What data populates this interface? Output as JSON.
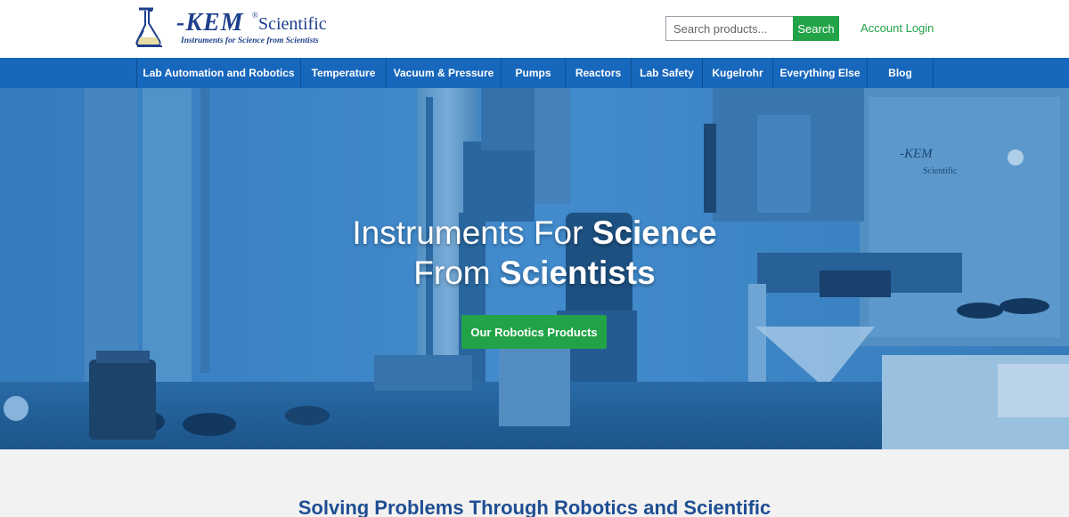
{
  "brand": {
    "logo_name": "-KEM",
    "logo_registered": "®",
    "logo_scientific": "Scientific",
    "logo_tagline": "Instruments for Science from Scientists",
    "primary_color": "#1767bc",
    "accent_color": "#22a348",
    "logo_color": "#1d3f8c"
  },
  "header": {
    "search_placeholder": "Search products...",
    "search_button": "Search",
    "account_login": "Account Login"
  },
  "nav": {
    "items": [
      {
        "label": "Lab Automation and Robotics"
      },
      {
        "label": "Temperature"
      },
      {
        "label": "Vacuum & Pressure"
      },
      {
        "label": "Pumps"
      },
      {
        "label": "Reactors"
      },
      {
        "label": "Lab Safety"
      },
      {
        "label": "Kugelrohr"
      },
      {
        "label": "Everything Else"
      },
      {
        "label": "Blog"
      }
    ]
  },
  "hero": {
    "line1_regular": "Instruments For ",
    "line1_bold": "Science",
    "line2_regular": "From ",
    "line2_bold": "Scientists",
    "cta_label": "Our Robotics Products",
    "machine_badge_line1": "-KEM",
    "machine_badge_line2": "Scientific"
  },
  "section": {
    "heading": "Solving Problems Through Robotics and Scientific"
  }
}
